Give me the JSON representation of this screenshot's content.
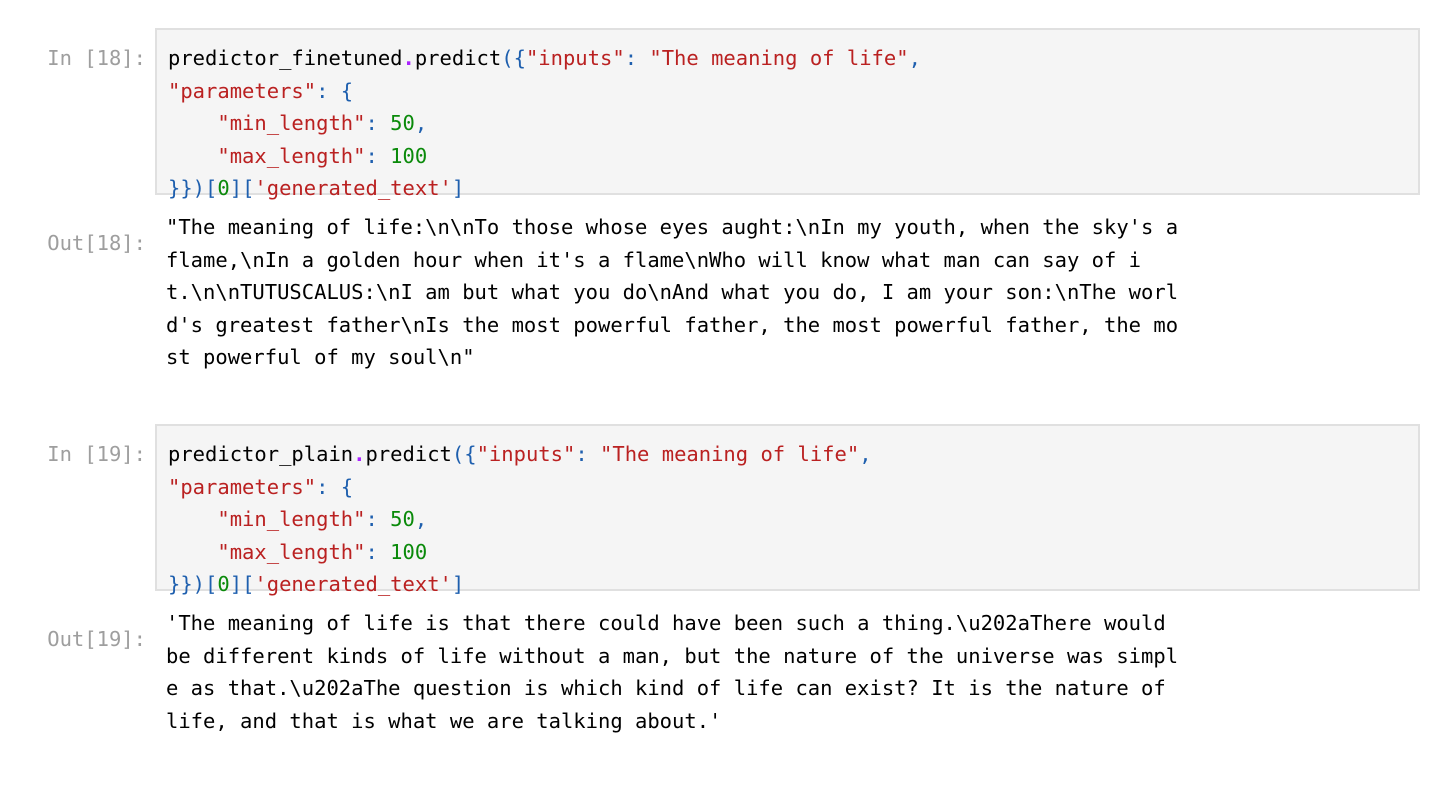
{
  "cells": [
    {
      "in_prompt": "In [18]:",
      "code": {
        "obj": "predictor_finetuned",
        "dot": ".",
        "method": "predict",
        "open": "({",
        "key_inputs": "\"inputs\"",
        "colon1": ": ",
        "val_inputs": "\"The meaning of life\"",
        "comma1": ",",
        "key_parameters": "\"parameters\"",
        "colon2": ": ",
        "brace_open": "{",
        "indent": "    ",
        "key_min": "\"min_length\"",
        "colon3": ": ",
        "val_min": "50",
        "comma2": ",",
        "key_max": "\"max_length\"",
        "colon4": ": ",
        "val_max": "100",
        "close": "}})",
        "idx_open": "[",
        "idx_val": "0",
        "idx_close": "]",
        "key_open": "[",
        "key_gen": "'generated_text'",
        "key_close": "]"
      },
      "out_prompt": "Out[18]:",
      "output_lines": [
        "\"The meaning of life:\\n\\nTo those whose eyes aught:\\nIn my youth, when the sky's a",
        "flame,\\nIn a golden hour when it's a flame\\nWho will know what man can say of i",
        "t.\\n\\nTUTUSCALUS:\\nI am but what you do\\nAnd what you do, I am your son:\\nThe worl",
        "d's greatest father\\nIs the most powerful father, the most powerful father, the mo",
        "st powerful of my soul\\n\""
      ]
    },
    {
      "in_prompt": "In [19]:",
      "code": {
        "obj": "predictor_plain",
        "dot": ".",
        "method": "predict",
        "open": "({",
        "key_inputs": "\"inputs\"",
        "colon1": ": ",
        "val_inputs": "\"The meaning of life\"",
        "comma1": ",",
        "key_parameters": "\"parameters\"",
        "colon2": ": ",
        "brace_open": "{",
        "indent": "    ",
        "key_min": "\"min_length\"",
        "colon3": ": ",
        "val_min": "50",
        "comma2": ",",
        "key_max": "\"max_length\"",
        "colon4": ": ",
        "val_max": "100",
        "close": "}})",
        "idx_open": "[",
        "idx_val": "0",
        "idx_close": "]",
        "key_open": "[",
        "key_gen": "'generated_text'",
        "key_close": "]"
      },
      "out_prompt": "Out[19]:",
      "output_lines": [
        "'The meaning of life is that there could have been such a thing.\\u202aThere would",
        "be different kinds of life without a man, but the nature of the universe was simpl",
        "e as that.\\u202aThe question is which kind of life can exist? It is the nature of",
        "life, and that is what we are talking about.'"
      ]
    }
  ],
  "colors": {
    "prompt": "#9e9e9e",
    "string": "#ba2121",
    "number": "#0a8a0a",
    "punctuation": "#1e5fae",
    "operator": "#aa22ff",
    "cell_background": "#f5f5f5",
    "cell_border": "#e0e0e0"
  }
}
